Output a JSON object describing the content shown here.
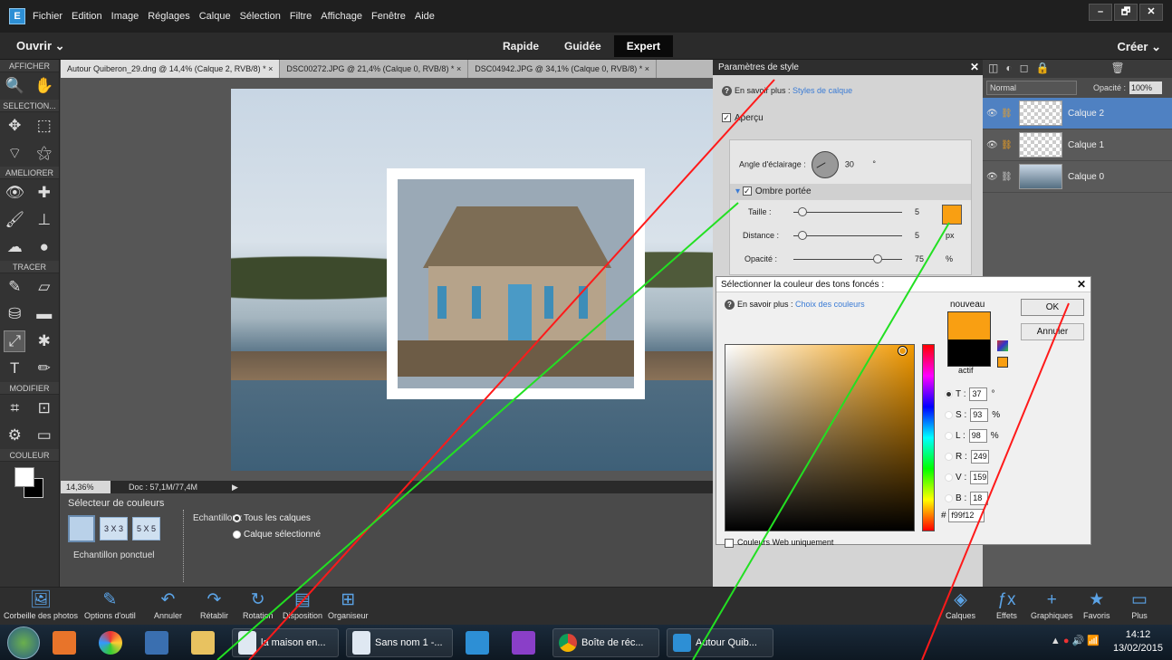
{
  "menu": [
    "Fichier",
    "Edition",
    "Image",
    "Réglages",
    "Calque",
    "Sélection",
    "Filtre",
    "Affichage",
    "Fenêtre",
    "Aide"
  ],
  "window_controls": [
    "–",
    "🗗",
    "✕"
  ],
  "modebar": {
    "open": "Ouvrir",
    "create": "Créer",
    "tabs": [
      "Rapide",
      "Guidée",
      "Expert"
    ],
    "active_tab": "Expert"
  },
  "toolbox": {
    "sections": {
      "view": "AFFICHER",
      "select": "SELECTION...",
      "enhance": "AMELIORER",
      "draw": "TRACER",
      "modify": "MODIFIER",
      "color": "COULEUR"
    }
  },
  "doc_tabs": [
    "Autour Quiberon_29.dng @ 14,4% (Calque 2, RVB/8) * ×",
    "DSC00272.JPG @ 21,4% (Calque 0, RVB/8) * ×",
    "DSC04942.JPG @ 34,1% (Calque 0, RVB/8) * ×"
  ],
  "statusbar": {
    "zoom": "14,36%",
    "doc": "Doc : 57,1M/77,4M"
  },
  "options": {
    "title": "Sélecteur de couleurs",
    "btn_3x3": "3 X 3",
    "btn_5x5": "5 X 5",
    "sample_label": "Echantillon ponctuel",
    "sample_from": "Echantillon.:",
    "all_layers": "Tous les calques",
    "selected_layer": "Calque sélectionné"
  },
  "style_panel": {
    "title": "Paramètres de style",
    "help_prefix": "En savoir plus :",
    "help_link": "Styles de calque",
    "preview": "Aperçu",
    "angle_label": "Angle d'éclairage :",
    "angle_value": "30",
    "angle_unit": "°",
    "drop_shadow": "Ombre portée",
    "size_label": "Taille :",
    "size_value": "5",
    "size_unit": "px",
    "distance_label": "Distance :",
    "distance_value": "5",
    "distance_unit": "px",
    "opacity_label": "Opacité :",
    "opacity_value": "75",
    "opacity_unit": "%"
  },
  "layers_panel": {
    "blend_mode": "Normal",
    "opacity_label": "Opacité :",
    "opacity_value": "100%",
    "layers": [
      {
        "name": "Calque 2",
        "selected": true
      },
      {
        "name": "Calque 1",
        "selected": false
      },
      {
        "name": "Calque 0",
        "selected": false
      }
    ]
  },
  "color_picker": {
    "title": "Sélectionner la couleur des tons foncés :",
    "help_prefix": "En savoir plus :",
    "help_link": "Choix des couleurs",
    "new_label": "nouveau",
    "active_label": "actif",
    "ok": "OK",
    "cancel": "Annuler",
    "fields": [
      {
        "label": "T :",
        "value": "37",
        "unit": "°",
        "checked": true
      },
      {
        "label": "S :",
        "value": "93",
        "unit": "%",
        "checked": false
      },
      {
        "label": "L :",
        "value": "98",
        "unit": "%",
        "checked": false
      },
      {
        "label": "R :",
        "value": "249",
        "unit": "",
        "checked": false
      },
      {
        "label": "V :",
        "value": "159",
        "unit": "",
        "checked": false
      },
      {
        "label": "B :",
        "value": "18",
        "unit": "",
        "checked": false
      }
    ],
    "hex_label": "#",
    "hex_value": "f99f12",
    "web_only": "Couleurs Web uniquement",
    "new_color": "#f99f12",
    "old_color": "#000000"
  },
  "bottom_bar": {
    "left": [
      "Corbeille des photos",
      "Options d'outil",
      "Annuler",
      "Rétablir",
      "Rotation",
      "Disposition",
      "Organiseur"
    ],
    "right": [
      "Calques",
      "Effets",
      "Graphiques",
      "Favoris",
      "Plus"
    ]
  },
  "taskbar": {
    "apps": [
      "la maison en...",
      "Sans nom 1 -...",
      "Boîte de réc...",
      "Autour Quib..."
    ],
    "time": "14:12",
    "date": "13/02/2015"
  }
}
